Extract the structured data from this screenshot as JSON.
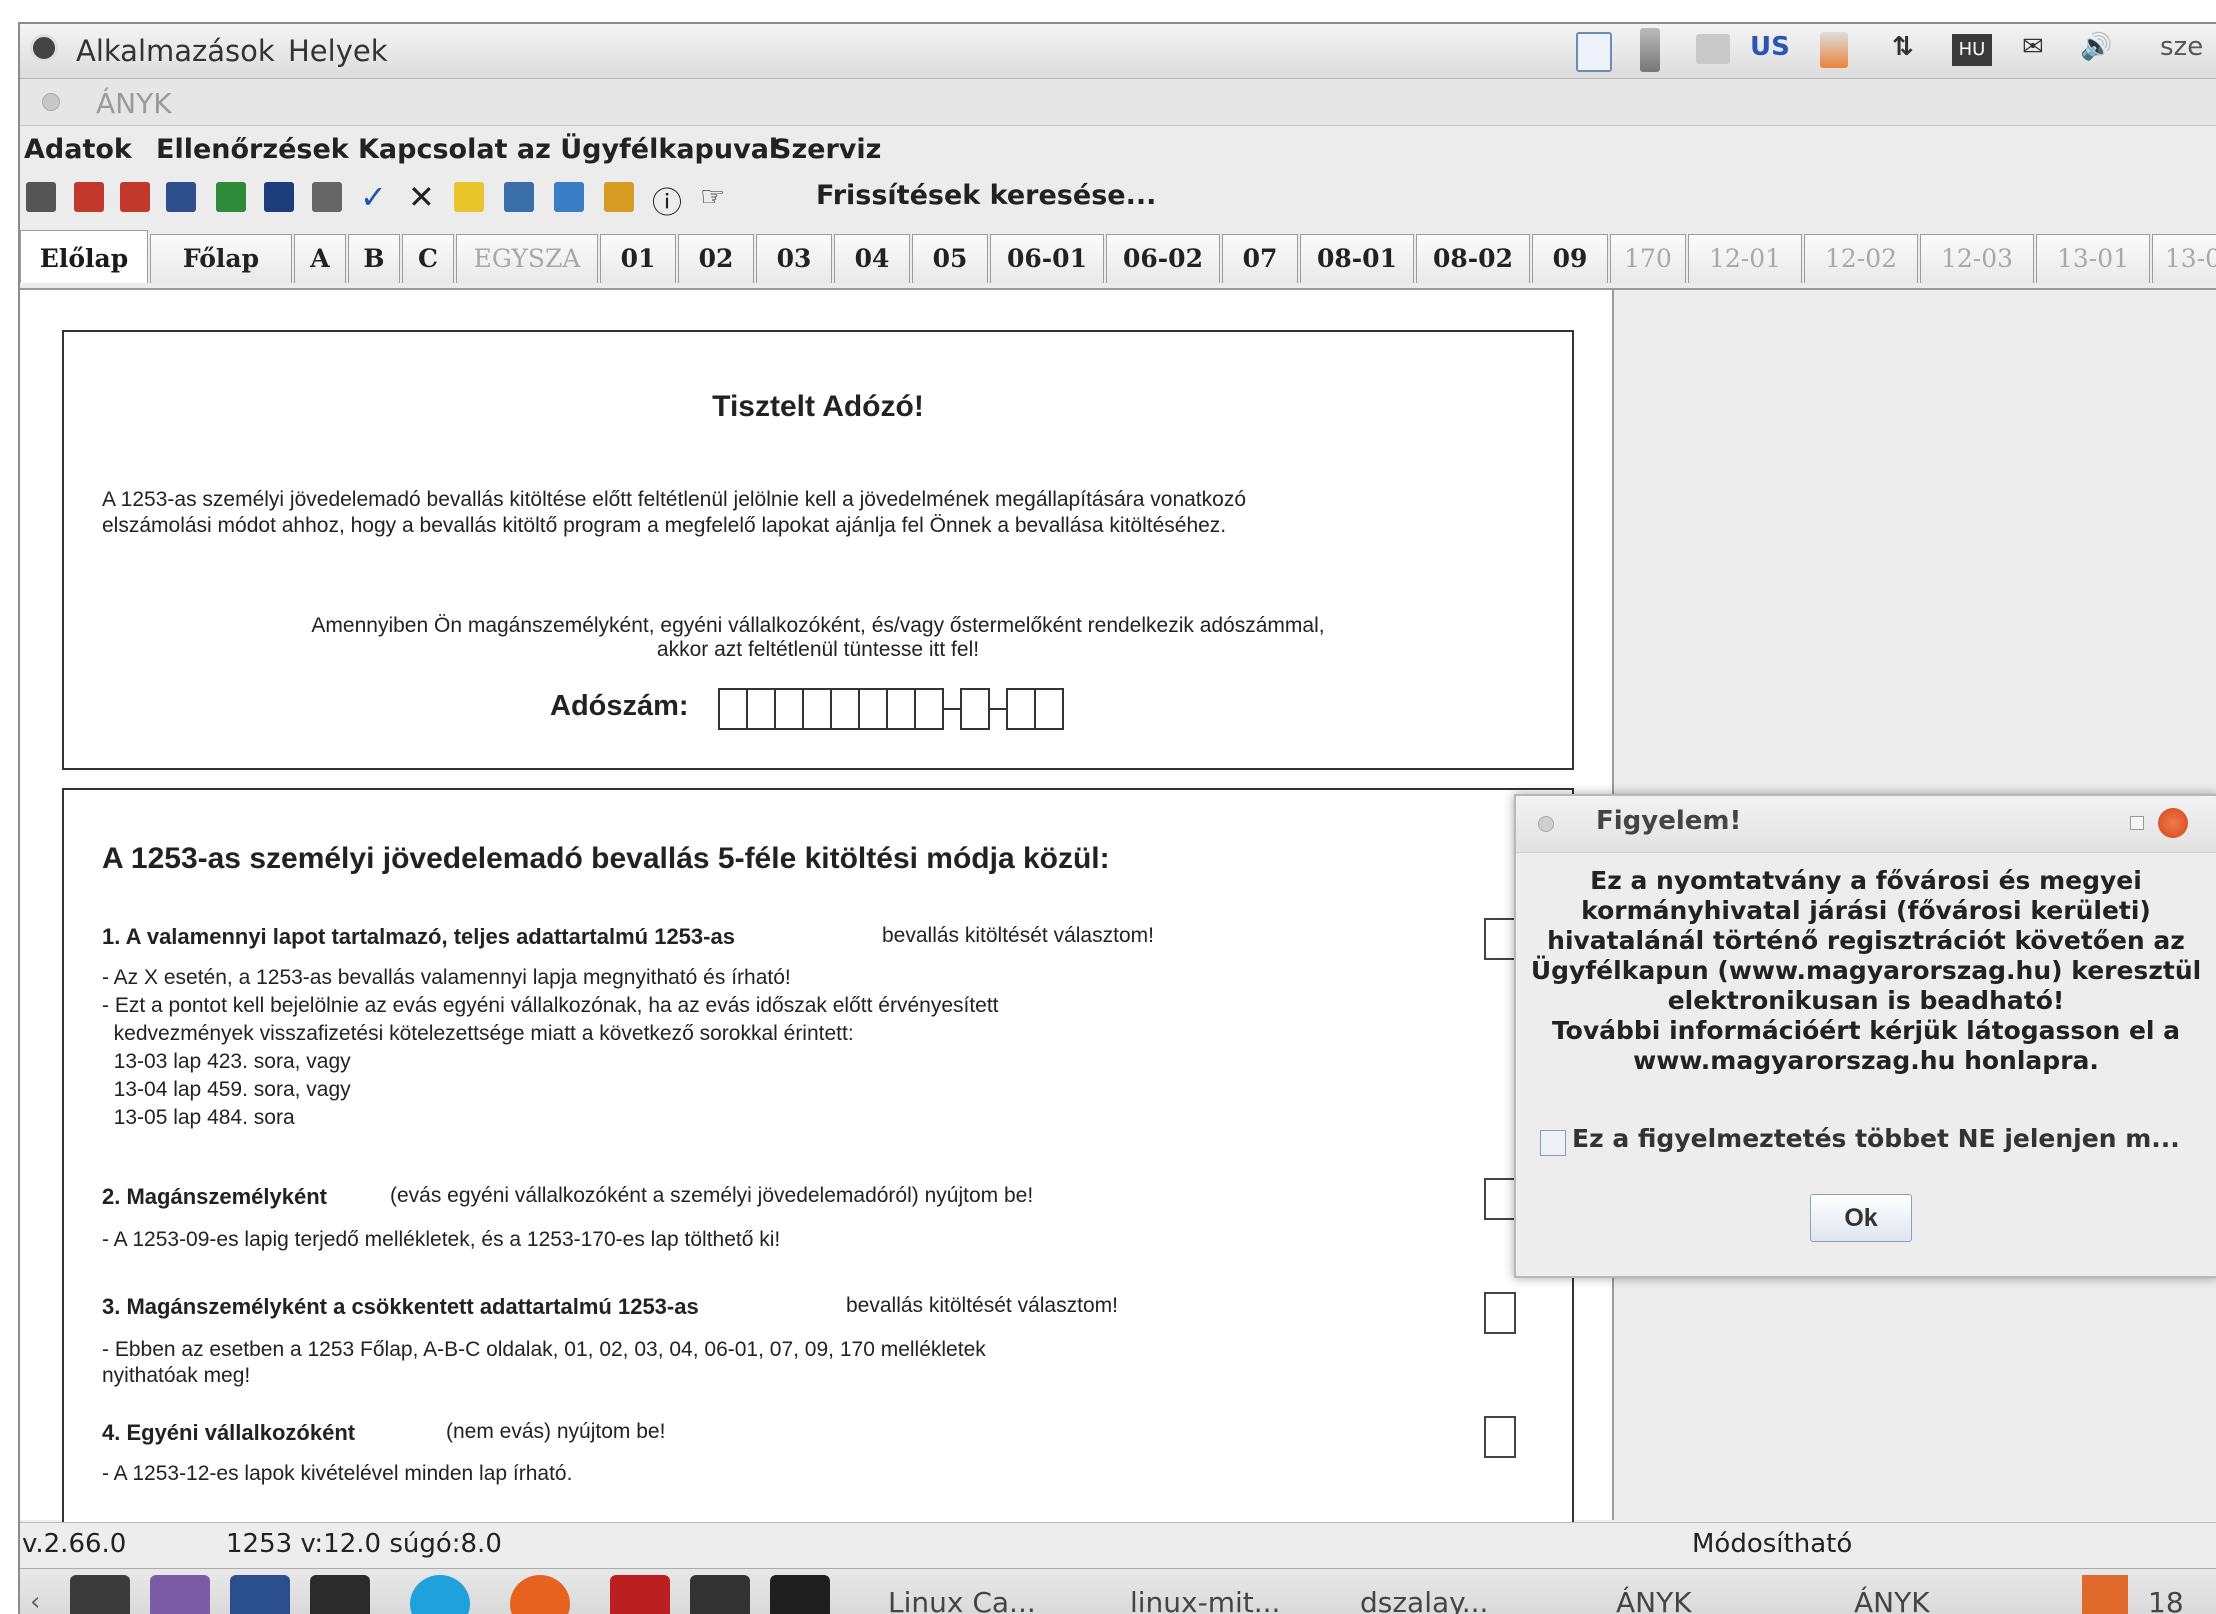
{
  "top_panel": {
    "applications": "Alkalmazások",
    "places": "Helyek",
    "keyboard": "US",
    "keyboard_badge": "HU",
    "clock_partial": "sze"
  },
  "window": {
    "title": "ÁNYK"
  },
  "menubar": [
    "Adatok",
    "Ellenőrzések",
    "Kapcsolat az Ügyfélkapuval",
    "Szerviz"
  ],
  "toolbar": {
    "update_label": "Frissítések keresése..."
  },
  "tabs": [
    {
      "label": "Előlap",
      "state": "active"
    },
    {
      "label": "Főlap",
      "state": "enabled"
    },
    {
      "label": "A",
      "state": "enabled"
    },
    {
      "label": "B",
      "state": "enabled"
    },
    {
      "label": "C",
      "state": "enabled"
    },
    {
      "label": "EGYSZA",
      "state": "disabled"
    },
    {
      "label": "01",
      "state": "enabled"
    },
    {
      "label": "02",
      "state": "enabled"
    },
    {
      "label": "03",
      "state": "enabled"
    },
    {
      "label": "04",
      "state": "enabled"
    },
    {
      "label": "05",
      "state": "enabled"
    },
    {
      "label": "06-01",
      "state": "enabled"
    },
    {
      "label": "06-02",
      "state": "enabled"
    },
    {
      "label": "07",
      "state": "enabled"
    },
    {
      "label": "08-01",
      "state": "enabled"
    },
    {
      "label": "08-02",
      "state": "enabled"
    },
    {
      "label": "09",
      "state": "enabled"
    },
    {
      "label": "170",
      "state": "disabled"
    },
    {
      "label": "12-01",
      "state": "disabled"
    },
    {
      "label": "12-02",
      "state": "disabled"
    },
    {
      "label": "12-03",
      "state": "disabled"
    },
    {
      "label": "13-01",
      "state": "disabled"
    },
    {
      "label": "13-0",
      "state": "disabled"
    }
  ],
  "form": {
    "greeting": "Tisztelt Adózó!",
    "intro_line1": "A 1253-as személyi jövedelemadó bevallás kitöltése előtt feltétlenül jelölnie kell a jövedelmének megállapítására vonatkozó",
    "intro_line2": "elszámolási módot ahhoz, hogy a bevallás kitöltő program a megfelelő lapokat ajánlja fel Önnek a bevallása kitöltéséhez.",
    "taxid_note_line1": "Amennyiben Ön magánszemélyként, egyéni vállalkozóként, és/vagy őstermelőként rendelkezik adószámmal,",
    "taxid_note_line2": "akkor azt feltétlenül tüntesse itt fel!",
    "taxid_label": "Adószám:",
    "modes_title": "A 1253-as személyi jövedelemadó bevallás 5-féle kitöltési módja közül:",
    "option1": {
      "title": "1.  A valamennyi lapot tartalmazó, teljes adattartalmú 1253-as",
      "suffix": "bevallás kitöltését választom!",
      "lines": [
        "- Az X esetén, a 1253-as bevallás valamennyi lapja megnyitható és írható!",
        "- Ezt a pontot kell bejelölnie az evás egyéni vállalkozónak, ha az evás időszak előtt érvényesített",
        "  kedvezmények visszafizetési kötelezettsége miatt a következő sorokkal érintett:",
        "  13-03 lap 423. sora, vagy",
        "  13-04 lap 459. sora, vagy",
        "  13-05 lap 484. sora"
      ]
    },
    "option2": {
      "title": "2.  Magánszemélyként",
      "suffix": "(evás egyéni vállalkozóként a személyi jövedelemadóról) nyújtom be!",
      "line": "- A 1253-09-es lapig terjedő mellékletek, és a 1253-170-es lap tölthető ki!"
    },
    "option3": {
      "title": "3.  Magánszemélyként a csökkentett adattartalmú 1253-as",
      "suffix": "bevallás kitöltését választom!",
      "line1": "- Ebben az esetben a 1253 Főlap, A-B-C oldalak, 01, 02, 03, 04, 06-01, 07, 09, 170 mellékletek",
      "line2": "nyithatóak meg!"
    },
    "option4": {
      "title": "4.  Egyéni vállalkozóként",
      "suffix": "(nem evás) nyújtom be!",
      "line": "- A 1253-12-es lapok kivételével minden lap írható."
    }
  },
  "status_bar": {
    "version": "v.2.66.0",
    "form_version": "1253 v:12.0 súgó:8.0",
    "mode": "Módosítható"
  },
  "dialog": {
    "title": "Figyelem!",
    "message": [
      "Ez a nyomtatvány a fővárosi és megyei",
      "kormányhivatal járási (fővárosi kerületi)",
      "hivatalánál történő regisztrációt követően az",
      "Ügyfélkapun (www.magyarorszag.hu) keresztül",
      "elektronikusan is beadható!",
      "További információért kérjük látogasson el a",
      "www.magyarorszag.hu honlapra."
    ],
    "checkbox_label": "Ez a figyelmeztetés többet NE jelenjen m...",
    "ok_label": "Ok"
  },
  "taskbar": {
    "tasks": [
      "Linux Ca...",
      "linux-mit...",
      "dszalay...",
      "ÁNYK",
      "ÁNYK"
    ],
    "clock_partial": "18"
  }
}
